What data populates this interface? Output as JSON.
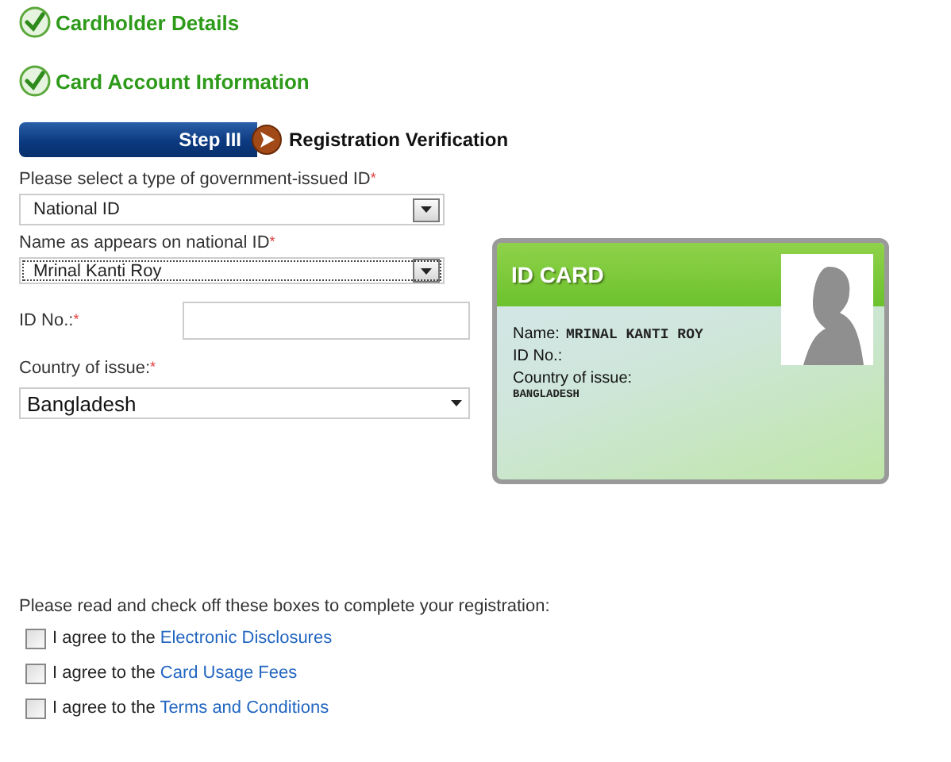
{
  "completed_steps": [
    {
      "label": "Cardholder Details",
      "done": true
    },
    {
      "label": "Card Account Information",
      "done": true
    }
  ],
  "current_step": {
    "badge": "Step III",
    "label": "Registration Verification"
  },
  "form": {
    "fields": [
      {
        "kind": "combo",
        "label": "Please select a type of government-issued ID",
        "required_mark": "*",
        "value": "National ID",
        "focused": false
      },
      {
        "kind": "combo",
        "label": "Name as appears on national ID",
        "required_mark": "*",
        "value": "Mrinal Kanti Roy",
        "focused": true
      },
      {
        "kind": "input",
        "label": "ID No.:",
        "required_mark": "*"
      },
      {
        "kind": "select",
        "label": "Country of issue:",
        "required_mark": "*",
        "value": "Bangladesh",
        "focused": false
      }
    ]
  },
  "id_card": {
    "title": "ID CARD",
    "rows": [
      {
        "label": "Name:",
        "value": "MRINAL KANTI ROY",
        "kind": "inline"
      },
      {
        "label": "ID No.:",
        "kind": "inline"
      },
      {
        "label": "Country of issue:",
        "value": "BANGLADESH",
        "kind": "stacked"
      }
    ]
  },
  "agreements": {
    "intro": "Please read and check off these boxes to complete your registration:",
    "items": [
      {
        "text": "I agree to the ",
        "link": "Electronic Disclosures",
        "checked": false
      },
      {
        "text": "I agree to the ",
        "link": "Card Usage Fees",
        "checked": false
      },
      {
        "text": "I agree to the ",
        "link": "Terms and Conditions",
        "checked": false
      }
    ]
  }
}
